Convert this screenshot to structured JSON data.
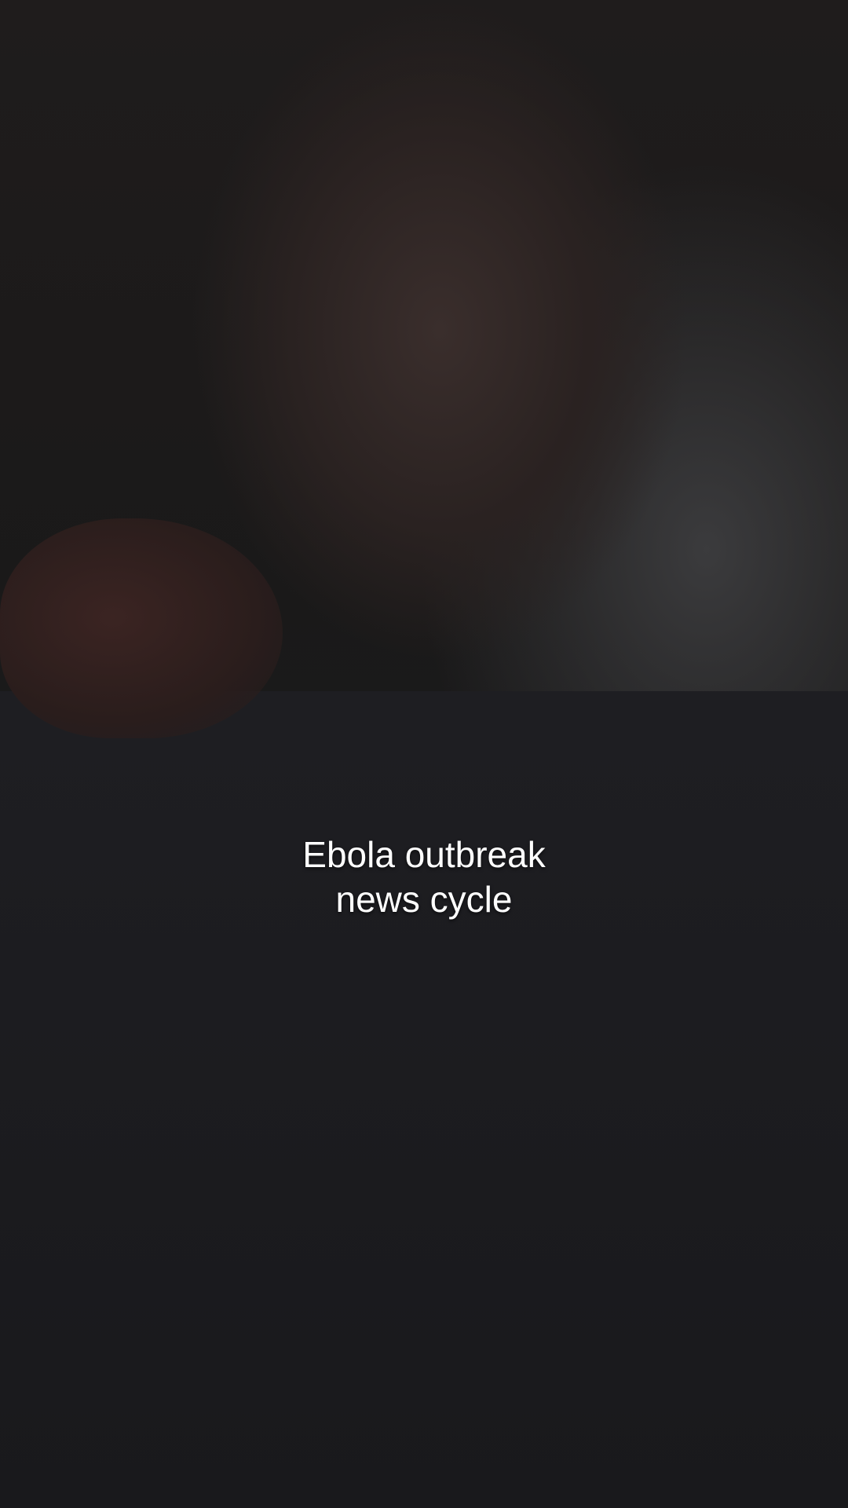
{
  "video": {
    "caption": {
      "line1": "Ebola outbreak",
      "line2": "news cycle"
    }
  },
  "colors": {
    "caption_text": "#ffffff",
    "background": "#121212"
  }
}
